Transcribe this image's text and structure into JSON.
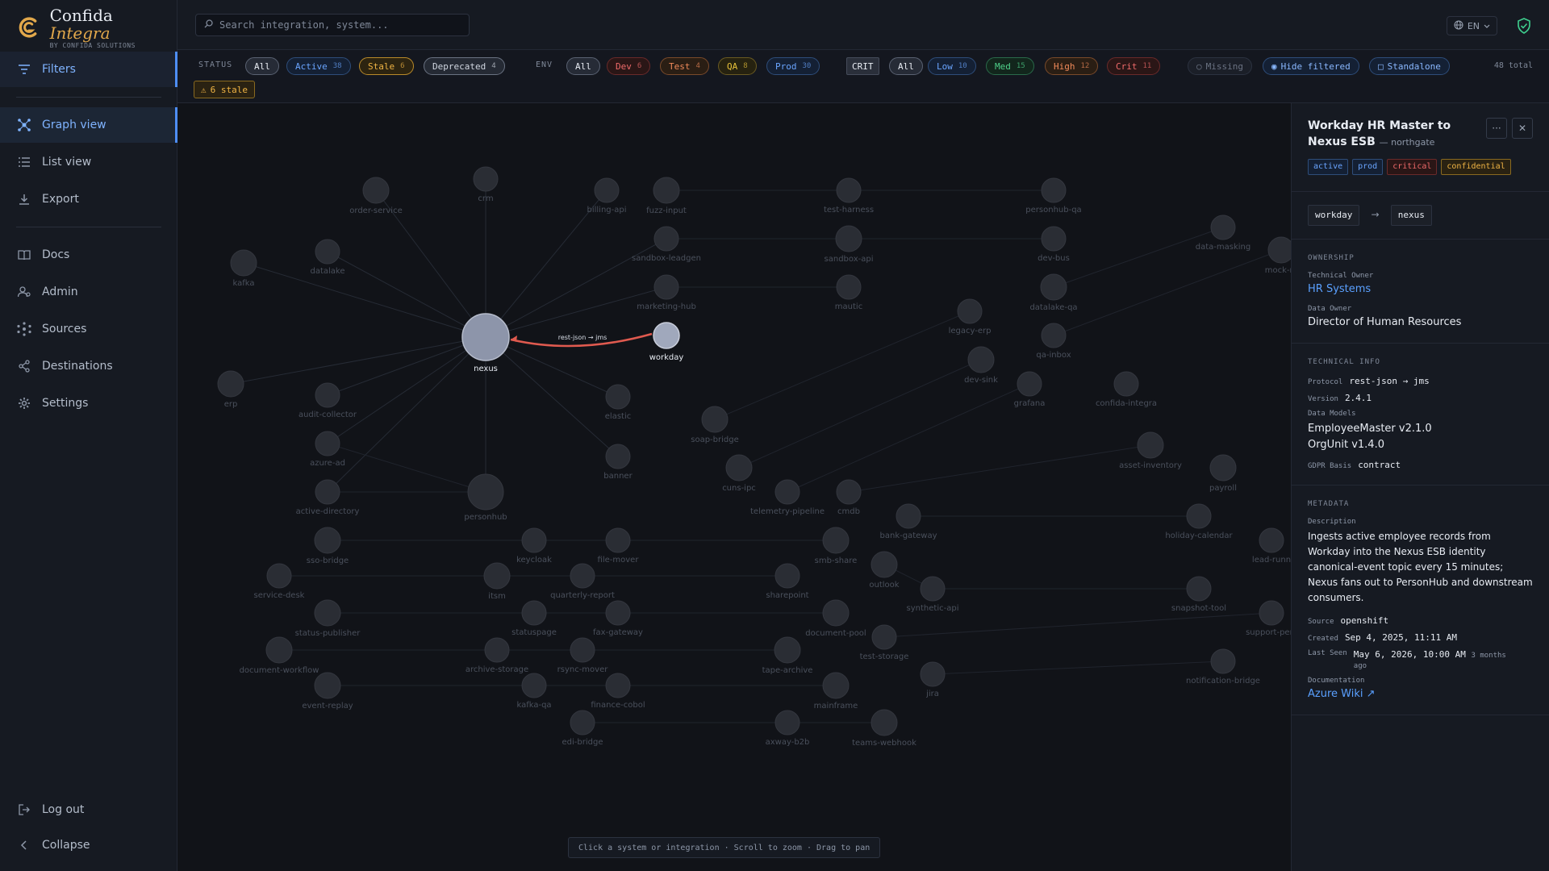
{
  "brand": {
    "name_main": "Confida",
    "name_accent": "Integra",
    "sub": "BY CONFIDA SOLUTIONS"
  },
  "sidebar": {
    "filters": "Filters",
    "items": [
      {
        "label": "Graph view",
        "icon": "graph-icon"
      },
      {
        "label": "List view",
        "icon": "list-icon"
      },
      {
        "label": "Export",
        "icon": "download-icon"
      },
      {
        "label": "Docs",
        "icon": "book-icon"
      },
      {
        "label": "Admin",
        "icon": "admin-icon"
      },
      {
        "label": "Sources",
        "icon": "sources-icon"
      },
      {
        "label": "Destinations",
        "icon": "share-icon"
      },
      {
        "label": "Settings",
        "icon": "gear-icon"
      }
    ],
    "logout": "Log out",
    "collapse": "Collapse"
  },
  "search": {
    "placeholder": "Search integration, system..."
  },
  "lang": "EN",
  "filters": {
    "status_label": "STATUS",
    "status": [
      {
        "label": "All"
      },
      {
        "label": "Active",
        "count": "38"
      },
      {
        "label": "Stale",
        "count": "6"
      },
      {
        "label": "Deprecated",
        "count": "4"
      }
    ],
    "env_label": "ENV",
    "env": [
      {
        "label": "All"
      },
      {
        "label": "Dev",
        "count": "6"
      },
      {
        "label": "Test",
        "count": "4"
      },
      {
        "label": "QA",
        "count": "8"
      },
      {
        "label": "Prod",
        "count": "30"
      }
    ],
    "crit_label": "CRIT",
    "crit": [
      {
        "label": "All"
      },
      {
        "label": "Low",
        "count": "10"
      },
      {
        "label": "Med",
        "count": "15"
      },
      {
        "label": "High",
        "count": "12"
      },
      {
        "label": "Crit",
        "count": "11"
      }
    ],
    "missing": "Missing",
    "hide_filtered": "Hide filtered",
    "standalone": "Standalone",
    "total": "48 total",
    "stale_badge": "6 stale"
  },
  "graph": {
    "hub": "nexus",
    "selected": "workday",
    "edge_label": "rest-json → jms",
    "hint": "Click a system or integration · Scroll to zoom · Drag to pan",
    "nodes": [
      "order-service",
      "crm",
      "billing-api",
      "fuzz-input",
      "test-harness",
      "personhub-qa",
      "kafka",
      "datalake",
      "sandbox-leadgen",
      "sandbox-api",
      "dev-bus",
      "data-masking",
      "mock-m",
      "marketing-hub",
      "mautic",
      "datalake-qa",
      "legacy-erp",
      "qa-inbox",
      "erp",
      "audit-collector",
      "elastic",
      "dev-sink",
      "grafana",
      "confida-integra",
      "soap-bridge",
      "azure-ad",
      "banner",
      "asset-inventory",
      "active-directory",
      "personhub",
      "cuns-ipc",
      "telemetry-pipeline",
      "cmdb",
      "payroll",
      "bank-gateway",
      "holiday-calendar",
      "sso-bridge",
      "keycloak",
      "file-mover",
      "smb-share",
      "lead-runn",
      "service-desk",
      "itsm",
      "quarterly-report",
      "sharepoint",
      "outlook",
      "synthetic-api",
      "snapshot-tool",
      "status-publisher",
      "statuspage",
      "fax-gateway",
      "document-pool",
      "test-storage",
      "support-pers",
      "document-workflow",
      "archive-storage",
      "rsync-mover",
      "tape-archive",
      "jira",
      "notification-bridge",
      "event-replay",
      "kafka-qa",
      "finance-cobol",
      "mainframe",
      "edi-bridge",
      "axway-b2b",
      "teams-webhook"
    ]
  },
  "panel": {
    "title": "Workday HR Master to Nexus ESB",
    "tenant": "— northgate",
    "tags": [
      "active",
      "prod",
      "critical",
      "confidential"
    ],
    "source": "workday",
    "target": "nexus",
    "ownership_head": "OWNERSHIP",
    "tech_owner_label": "Technical Owner",
    "tech_owner": "HR Systems",
    "data_owner_label": "Data Owner",
    "data_owner": "Director of Human Resources",
    "tech_head": "TECHNICAL INFO",
    "protocol_label": "Protocol",
    "protocol": "rest-json → jms",
    "version_label": "Version",
    "version": "2.4.1",
    "models_label": "Data Models",
    "model_1": "EmployeeMaster v2.1.0",
    "model_2": "OrgUnit v1.4.0",
    "gdpr_label": "GDPR Basis",
    "gdpr": "contract",
    "meta_head": "METADATA",
    "desc_label": "Description",
    "desc": "Ingests active employee records from Workday into the Nexus ESB identity canonical-event topic every 15 minutes; Nexus fans out to PersonHub and downstream consumers.",
    "src_label": "Source",
    "src": "openshift",
    "created_label": "Created",
    "created": "Sep 4, 2025, 11:11 AM",
    "lastseen_label": "Last Seen",
    "lastseen": "May 6, 2026, 10:00 AM",
    "lastseen_rel": "3 months ago",
    "doc_label": "Documentation",
    "doc": "Azure Wiki ↗"
  },
  "colors": {
    "accent": "#4e8ef7",
    "edge_selected": "#e05a4f",
    "stale": "#f0b444",
    "brand": "#e2a84b"
  }
}
